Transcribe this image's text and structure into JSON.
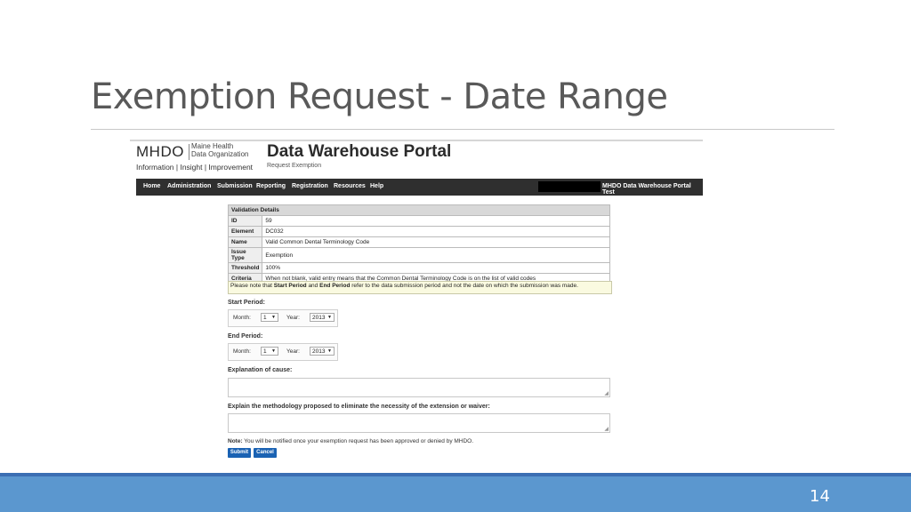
{
  "slide": {
    "title": "Exemption Request - Date Range",
    "page_number": "14"
  },
  "logo": {
    "abbr": "MHDO",
    "org_line1": "Maine Health",
    "org_line2": "Data Organization",
    "tagline": "Information | Insight | Improvement"
  },
  "portal": {
    "title": "Data Warehouse Portal",
    "subtitle": "Request Exemption"
  },
  "nav": {
    "items": [
      "Home",
      "Administration",
      "Submission",
      "Reporting",
      "Registration",
      "Resources",
      "Help"
    ],
    "right_label": "MHDO Data Warehouse Portal Test"
  },
  "validation": {
    "header": "Validation Details",
    "rows": [
      {
        "key": "ID",
        "value": "59"
      },
      {
        "key": "Element",
        "value": "DC032"
      },
      {
        "key": "Name",
        "value": "Valid Common Dental Terminology Code"
      },
      {
        "key": "Issue Type",
        "value": "Exemption"
      },
      {
        "key": "Threshold",
        "value": "100%"
      },
      {
        "key": "Criteria",
        "value": "When not blank, valid entry means that the Common Dental Terminology Code is on the list of valid codes"
      }
    ]
  },
  "notice": {
    "part1": "Please note that ",
    "start": "Start Period",
    "part2": " and ",
    "end": "End Period",
    "part3": " refer to the data submission period and not the date on which the submission was made."
  },
  "start_period": {
    "label": "Start Period:",
    "month_label": "Month:",
    "month": "1",
    "year_label": "Year:",
    "year": "2013"
  },
  "end_period": {
    "label": "End Period:",
    "month_label": "Month:",
    "month": "1",
    "year_label": "Year:",
    "year": "2013"
  },
  "explanation": {
    "label": "Explanation of cause:",
    "value": ""
  },
  "methodology": {
    "label": "Explain the methodology proposed to eliminate the necessity of the extension or waiver:",
    "value": ""
  },
  "note": {
    "label": "Note:",
    "text": " You will be notified once your exemption request has been approved or denied by MHDO."
  },
  "buttons": {
    "submit": "Submit",
    "cancel": "Cancel"
  },
  "colors": {
    "footer": "#5b97cf",
    "nav": "#2f2f2f",
    "button": "#1a62b3"
  }
}
